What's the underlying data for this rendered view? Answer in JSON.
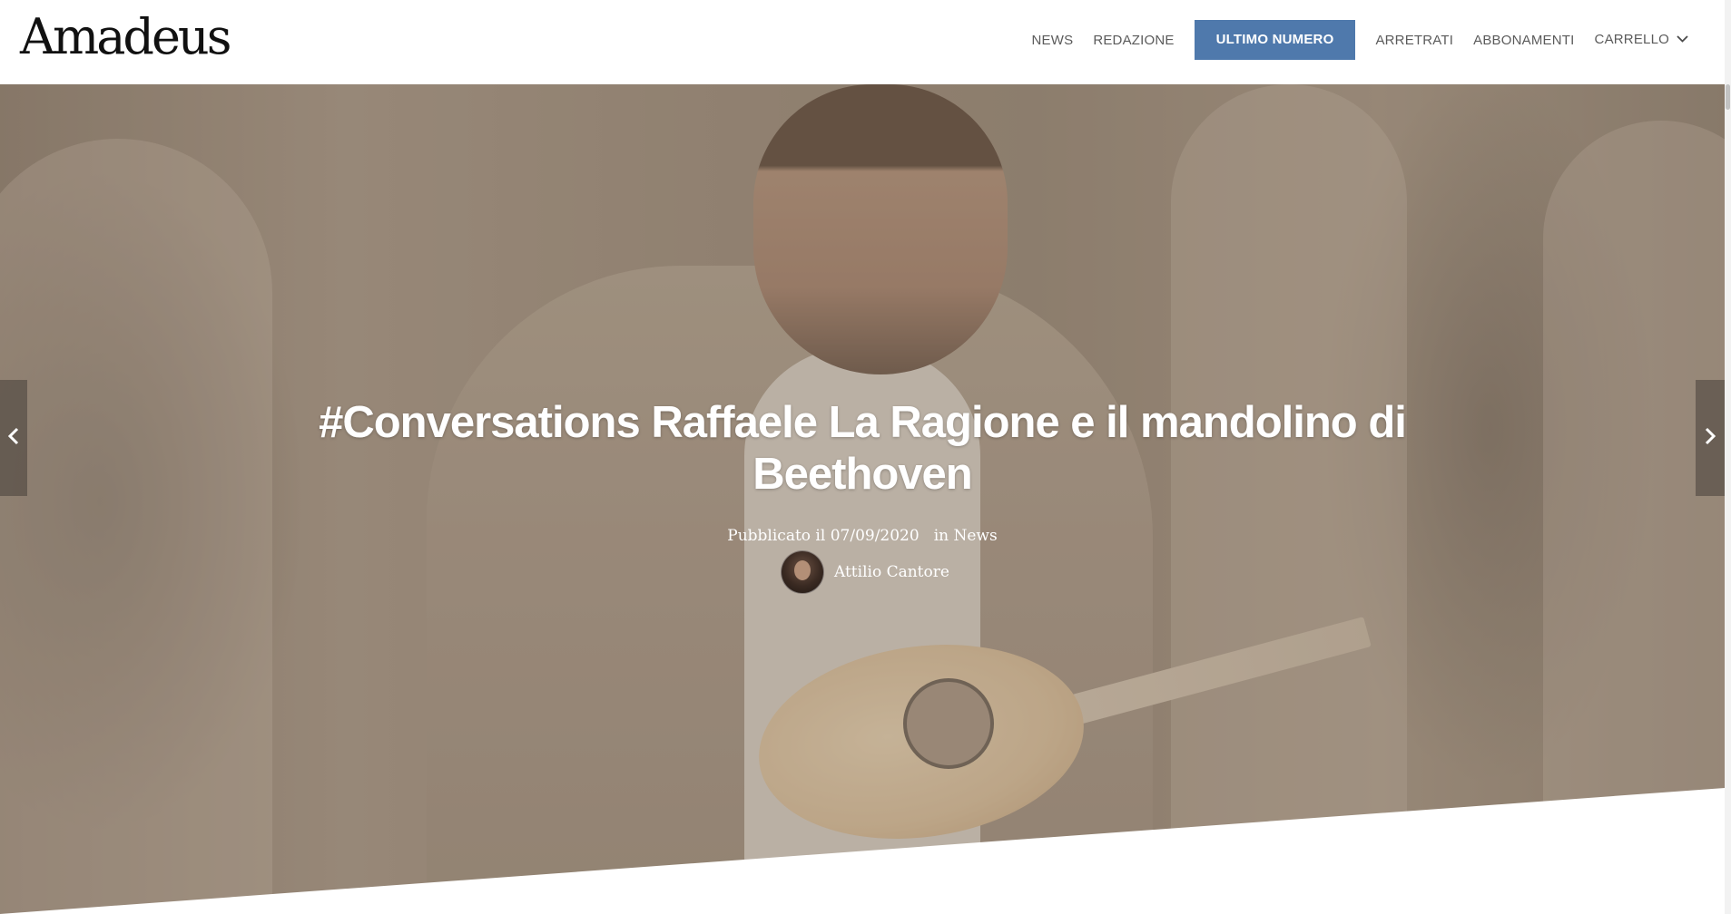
{
  "site": {
    "logo_text": "Amadeus"
  },
  "nav": {
    "items": [
      {
        "label": "NEWS"
      },
      {
        "label": "REDAZIONE"
      },
      {
        "label": "ULTIMO NUMERO",
        "highlighted": true
      },
      {
        "label": "ARRETRATI"
      },
      {
        "label": "ABBONAMENTI"
      },
      {
        "label": "CARRELLO",
        "has_dropdown": true
      }
    ],
    "cta_color": "#4f79ac"
  },
  "article": {
    "title": "#Conversations Raffaele La Ragione e il mandolino di Beethoven",
    "published_label": "Pubblicato il 07/09/2020",
    "category_prefix": "in",
    "category": "News",
    "author": "Attilio Cantore"
  },
  "icons": {
    "prev": "chevron-left-icon",
    "next": "chevron-right-icon",
    "dropdown": "chevron-down-icon"
  }
}
